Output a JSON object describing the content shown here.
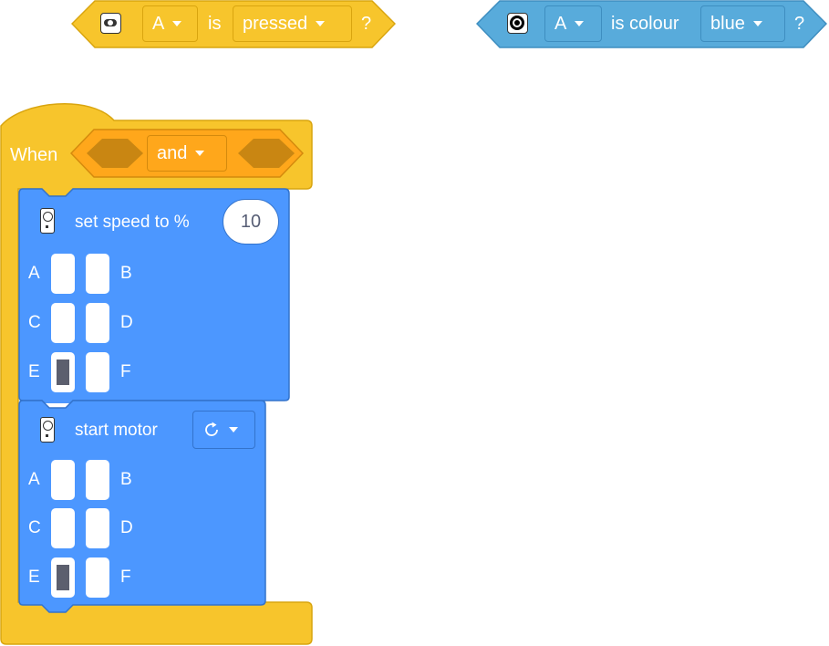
{
  "colors": {
    "event_yellow": "#F7C52C",
    "sensor_blue": "#58ABDB",
    "motor_blue": "#4C97FF",
    "operator_orange": "#FFA71B",
    "port_active": "#5C5F6E"
  },
  "button_block": {
    "icon": "button-sensor-icon",
    "port": "A",
    "is_label": "is",
    "state": "pressed",
    "question": "?"
  },
  "colour_block": {
    "icon": "colour-sensor-icon",
    "port": "A",
    "is_label": "is colour",
    "colour": "blue",
    "question": "?"
  },
  "when_block": {
    "label": "When",
    "operator": "and"
  },
  "set_speed_block": {
    "icon": "hub-icon",
    "label": "set speed to %",
    "value": "10",
    "ports": {
      "a": "A",
      "b": "B",
      "c": "C",
      "d": "D",
      "e": "E",
      "f": "F"
    },
    "active_port": "E"
  },
  "start_motor_block": {
    "icon": "hub-icon",
    "label": "start motor",
    "direction_icon": "rotate-clockwise-icon",
    "ports": {
      "a": "A",
      "b": "B",
      "c": "C",
      "d": "D",
      "e": "E",
      "f": "F"
    },
    "active_port": "E"
  }
}
